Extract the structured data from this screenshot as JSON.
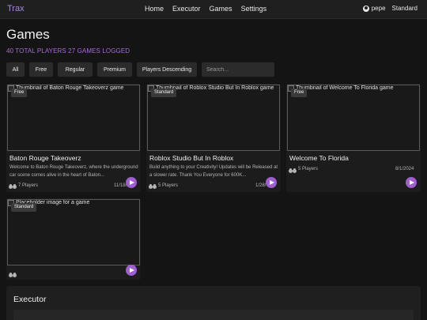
{
  "nav": {
    "brand": "Trax",
    "links": [
      "Home",
      "Executor",
      "Games",
      "Settings"
    ],
    "username": "pepe",
    "plan": "Standard"
  },
  "page": {
    "title": "Games",
    "stats": "40 TOTAL PLAYERS 27 GAMES LOGGED"
  },
  "filters": {
    "buttons": [
      "All",
      "Free",
      "Regular",
      "Premium",
      "Players Descending"
    ],
    "search_placeholder": "Search..."
  },
  "games": [
    {
      "thumb_alt": "Thumbnail of Baton Rouge Takeoverz game",
      "badge": "Free",
      "title": "Baton Rouge Takeoverz",
      "description": "Welcome to Baton Rouge Takeoverz, where the underground car scene comes alive in the heart of Baton...",
      "players": "7 Players",
      "date": "11/18/"
    },
    {
      "thumb_alt": "Thumbnail of Roblox Studio But In Roblox game",
      "badge": "Standard",
      "title": "Roblox Studio But In Roblox",
      "description": "Build anything to your Creativity! Updates will be Released at a slower rate. Thank You Everyone for 600K...",
      "players": "5 Players",
      "date": "1/28/"
    },
    {
      "thumb_alt": "Thumbnail of Welcome To Florida game",
      "badge": "Free",
      "title": "Welcome To Florida",
      "description": "",
      "players": "5 Players",
      "date": "8/1/2024"
    },
    {
      "thumb_alt": "Placeholder image for a game",
      "badge": "Standard",
      "title": "",
      "description": "",
      "players": "",
      "date": ""
    }
  ],
  "executor": {
    "title": "Executor"
  },
  "colors": {
    "accent": "#a05fd0",
    "brand": "#a78bdc",
    "stats": "#a56bdd",
    "background": "#141414",
    "card": "#1c1c1c"
  },
  "icons": {
    "user": "user-circle-icon",
    "players": "users-icon",
    "play": "play-icon",
    "broken_image": "broken-image-icon"
  }
}
